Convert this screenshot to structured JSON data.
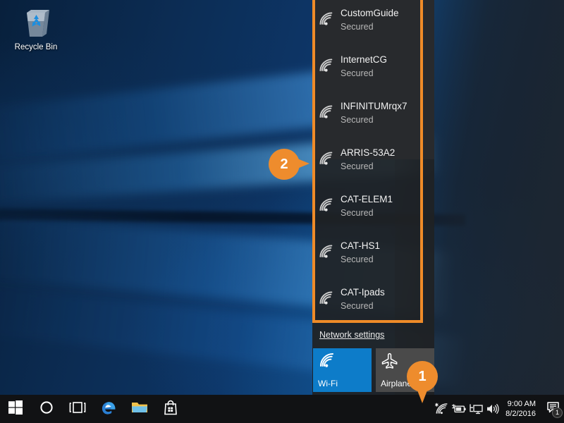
{
  "desktop": {
    "icons": [
      {
        "label": "Recycle Bin",
        "icon": "recycle-bin-icon"
      }
    ]
  },
  "flyout": {
    "networks": [
      {
        "name": "CustomGuide",
        "status": "Secured",
        "icon": "wifi-signal-icon"
      },
      {
        "name": "InternetCG",
        "status": "Secured",
        "icon": "wifi-signal-icon"
      },
      {
        "name": "INFINITUMrqx7",
        "status": "Secured",
        "icon": "wifi-signal-icon"
      },
      {
        "name": "ARRIS-53A2",
        "status": "Secured",
        "icon": "wifi-signal-icon"
      },
      {
        "name": "CAT-ELEM1",
        "status": "Secured",
        "icon": "wifi-signal-icon"
      },
      {
        "name": "CAT-HS1",
        "status": "Secured",
        "icon": "wifi-signal-icon"
      },
      {
        "name": "CAT-Ipads",
        "status": "Secured",
        "icon": "wifi-signal-icon"
      }
    ],
    "settings_link": "Network settings",
    "tiles": [
      {
        "label": "Wi-Fi",
        "icon": "wifi-signal-icon",
        "state": "on"
      },
      {
        "label": "Airplane mode",
        "icon": "airplane-icon",
        "state": "off"
      }
    ]
  },
  "taskbar": {
    "buttons": [
      {
        "name": "start-button",
        "icon": "windows-logo-icon"
      },
      {
        "name": "cortana-button",
        "icon": "circle-icon"
      },
      {
        "name": "task-view-button",
        "icon": "task-view-icon"
      },
      {
        "name": "edge-button",
        "icon": "edge-icon"
      },
      {
        "name": "file-explorer-button",
        "icon": "folder-icon"
      },
      {
        "name": "store-button",
        "icon": "shopping-bag-icon"
      }
    ],
    "tray_icons": [
      {
        "name": "wifi-tray-icon",
        "icon": "wifi-signal-icon"
      },
      {
        "name": "battery-tray-icon",
        "icon": "battery-charging-icon"
      },
      {
        "name": "network-tray-icon",
        "icon": "monitor-network-icon"
      },
      {
        "name": "volume-tray-icon",
        "icon": "speaker-icon"
      }
    ],
    "clock": {
      "time": "9:00 AM",
      "date": "8/2/2016"
    },
    "action_center": {
      "icon": "speech-bubble-icon",
      "badge": "1"
    }
  },
  "annotations": {
    "callout_1": "1",
    "callout_2": "2",
    "accent_color": "#ee8c2d"
  }
}
